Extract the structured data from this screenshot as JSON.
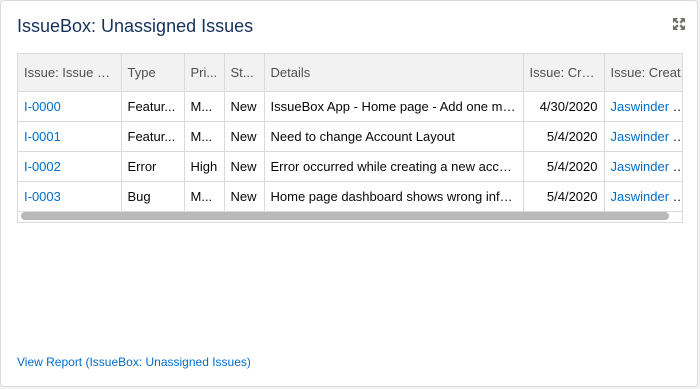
{
  "card": {
    "title": "IssueBox: Unassigned Issues",
    "expand_icon": "expand-icon",
    "report_link": "View Report (IssueBox: Unassigned Issues)"
  },
  "table": {
    "headers": [
      "Issue: Issue N...",
      "Type",
      "Pri...",
      "St...",
      "Details",
      "Issue: Cre...",
      "Issue: Creat..."
    ],
    "rows": [
      {
        "issue": "I-0000",
        "type": "Featur...",
        "priority": "M...",
        "status": "New",
        "details": "IssueBox App - Home page - Add one mor...",
        "created": "4/30/2020",
        "creator": "Jaswinder R..."
      },
      {
        "issue": "I-0001",
        "type": "Featur...",
        "priority": "M...",
        "status": "New",
        "details": "Need to change Account Layout",
        "created": "5/4/2020",
        "creator": "Jaswinder R..."
      },
      {
        "issue": "I-0002",
        "type": "Error",
        "priority": "High",
        "status": "New",
        "details": "Error occurred while creating a new account",
        "created": "5/4/2020",
        "creator": "Jaswinder R..."
      },
      {
        "issue": "I-0003",
        "type": "Bug",
        "priority": "M...",
        "status": "New",
        "details": "Home page dashboard shows wrong infor...",
        "created": "5/4/2020",
        "creator": "Jaswinder R..."
      }
    ]
  },
  "colors": {
    "title": "#16325c",
    "link": "#006dcc",
    "header_bg": "#f3f2f2",
    "border": "#dddbda"
  }
}
